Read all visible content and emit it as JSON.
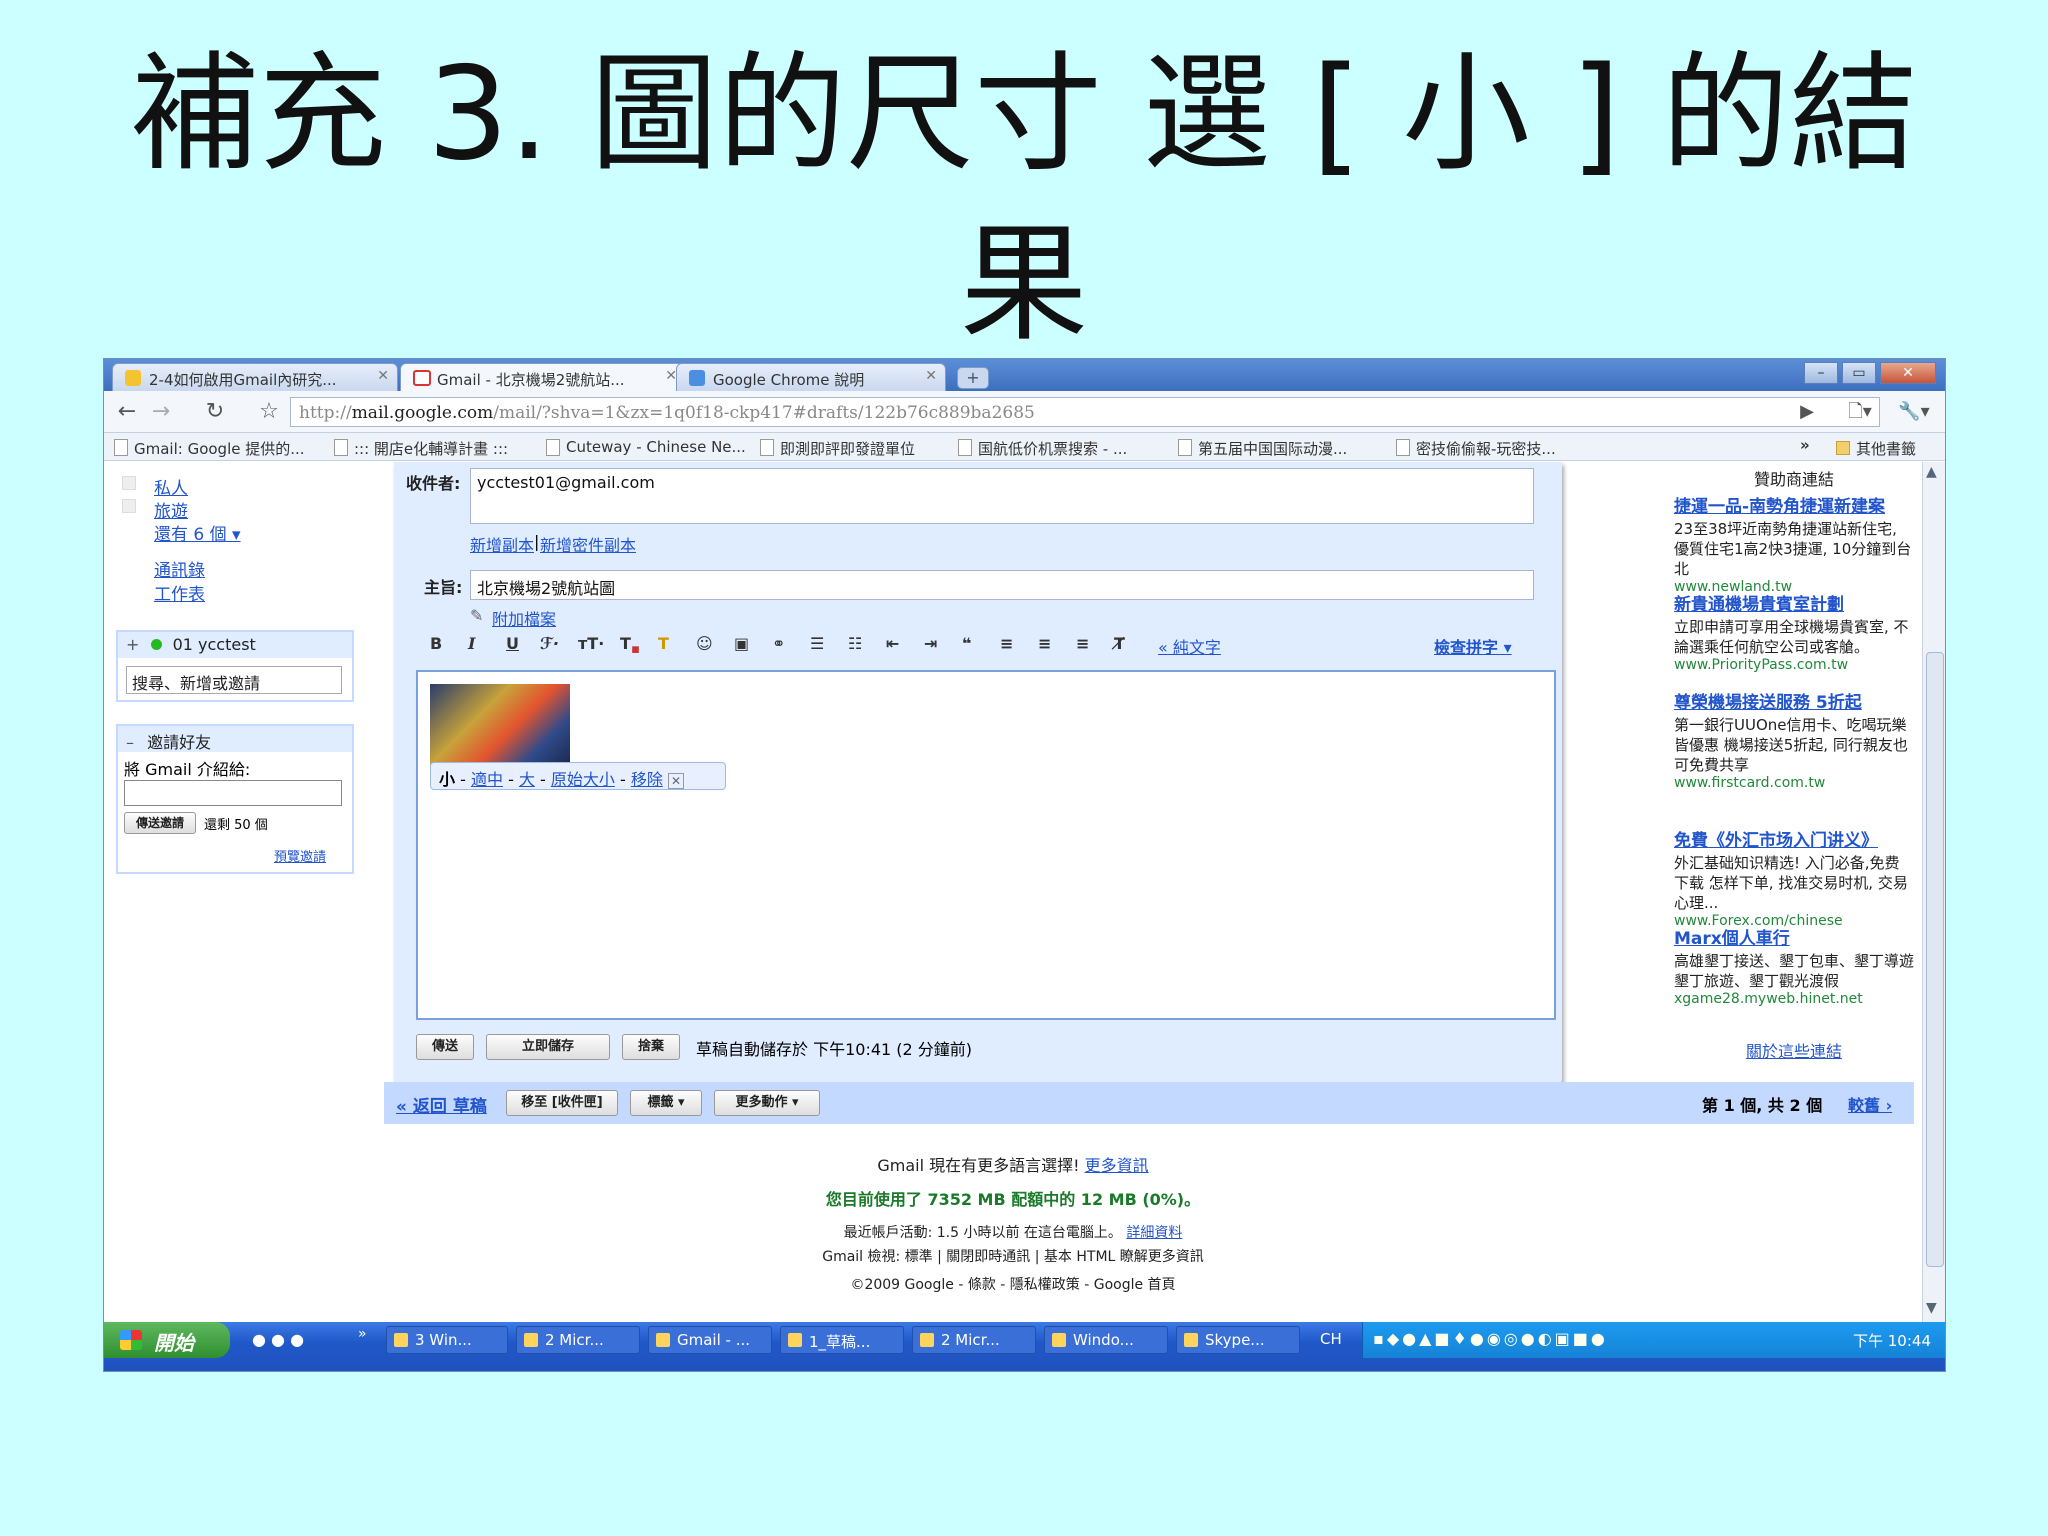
{
  "slide": {
    "title_line1": "補充 3. 圖的尺寸 選 [ 小 ] 的結",
    "title_line2": "果"
  },
  "browser": {
    "tabs": [
      {
        "label": "2-4如何啟用Gmail內研究...",
        "icon": "google-docs-icon",
        "active": false
      },
      {
        "label": "Gmail - 北京機場2號航站...",
        "icon": "gmail-icon",
        "active": true
      },
      {
        "label": "Google Chrome 說明",
        "icon": "google-icon",
        "active": false
      }
    ],
    "new_tab_label": "+",
    "url_prefix": "http://",
    "url_host": "mail.google.com",
    "url_path": "/mail/?shva=1&zx=1q0f18-ckp417#drafts/122b76c889ba2685",
    "bookmarks": [
      "Gmail: Google 提供的...",
      "::: 開店e化輔導計畫 :::",
      "Cuteway - Chinese Ne...",
      "即測即評即發證單位",
      "国航低价机票搜索 - ...",
      "第五届中国国际动漫...",
      "密技偷偷報-玩密技..."
    ],
    "bookmarks_more": "»",
    "other_bookmarks": "其他書籤"
  },
  "sidebar": {
    "labels": [
      "私人",
      "旅遊"
    ],
    "more_labels": "還有 6 個 ▾",
    "contacts": "通訊錄",
    "tasks": "工作表",
    "chat_header": "01 ycctest",
    "chat_search_placeholder": "搜尋、新增或邀請",
    "invite_header": "邀請好友",
    "invite_prompt": "將 Gmail 介紹給:",
    "invite_button": "傳送邀請",
    "invite_remaining": "還剩 50 個",
    "invite_preview": "預覽邀請"
  },
  "compose": {
    "to_label": "收件者:",
    "to_value": "ycctest01@gmail.com",
    "add_cc": "新增副本",
    "add_bcc": "新增密件副本",
    "subject_label": "主旨:",
    "subject_value": "北京機場2號航站圖",
    "attach": "附加檔案",
    "plain_text": "« 純文字",
    "spellcheck": "檢查拼字 ▾",
    "image_size_label": "小",
    "image_size_medium": "適中",
    "image_size_large": "大",
    "image_size_original": "原始大小",
    "image_remove": "移除",
    "send": "傳送",
    "save_now": "立即儲存",
    "discard": "捨棄",
    "autosave": "草稿自動儲存於 下午10:41 (2 分鐘前)"
  },
  "nav": {
    "back": "« 返回 草稿",
    "move_to": "移至 [收件匣]",
    "labels": "標籤 ▾",
    "more_actions": "更多動作 ▾",
    "paging_prefix": "第 1 個, 共 2 個",
    "older": "較舊 ›"
  },
  "ads": {
    "header": "贊助商連結",
    "items": [
      {
        "title": "捷運一品-南勢角捷運新建案",
        "desc": "23至38坪近南勢角捷運站新住宅, 優質住宅1高2快3捷運, 10分鐘到台北",
        "url": "www.newland.tw"
      },
      {
        "title": "新貴通機場貴賓室計劃",
        "desc": "立即申請可享用全球機場貴賓室, 不論選乘任何航空公司或客艙。",
        "url": "www.PriorityPass.com.tw"
      },
      {
        "title": "尊榮機場接送服務 5折起",
        "desc": "第一銀行UUOne信用卡、吃喝玩樂皆優惠 機場接送5折起, 同行親友也可免費共享",
        "url": "www.firstcard.com.tw"
      },
      {
        "title": "免費《外汇市场入门讲义》",
        "desc": "外汇基础知识精选! 入门必备,免费下载 怎样下单, 找准交易时机, 交易心理...",
        "url": "www.Forex.com/chinese"
      },
      {
        "title": "Marx個人車行",
        "desc": "高雄墾丁接送、墾丁包車、墾丁導遊 墾丁旅遊、墾丁觀光渡假",
        "url": "xgame28.myweb.hinet.net"
      }
    ],
    "about": "關於這些連結"
  },
  "footer": {
    "languages": "Gmail 現在有更多語言選擇!",
    "learn_more": "更多資訊",
    "usage": "您目前使用了 7352 MB 配額中的 12 MB (0%)。",
    "activity": "最近帳戶活動: 1.5 小時以前 在這台電腦上。",
    "details": "詳細資料",
    "view": "Gmail 檢視: 標準 | 關閉即時通訊 | 基本 HTML 瞭解更多資訊",
    "copyright": "©2009 Google - 條款 - 隱私權政策 - Google 首頁"
  },
  "taskbar": {
    "start": "開始",
    "quicklaunch_more": "»",
    "buttons": [
      "3 Win...",
      "2 Micr...",
      "Gmail - ...",
      "1_草稿...",
      "2 Micr...",
      "Windo...",
      "Skype..."
    ],
    "ime": "CH",
    "clock": "下午 10:44"
  },
  "colors": {
    "slide_bg": "#ccffff",
    "link": "#2255cc",
    "gmail_panel": "#e0ecff",
    "taskbar": "#2058c9"
  }
}
